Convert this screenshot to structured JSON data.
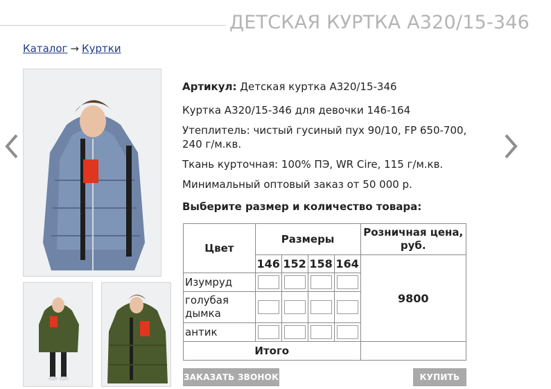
{
  "page": {
    "title": "ДЕТСКАЯ КУРТКА А320/15-346"
  },
  "breadcrumb": {
    "catalog": "Каталог",
    "separator": "→",
    "category": "Куртки"
  },
  "nav": {
    "prev_icon": "chevron-left-icon",
    "next_icon": "chevron-right-icon",
    "prev_glyph": "‹",
    "next_glyph": "›"
  },
  "product": {
    "article_label": "Артикул:",
    "article_value": "Детская куртка А320/15-346",
    "description": "Куртка А320/15-346 для девочки 146-164",
    "insulation": "Утеплитель: чистый гусиный пух 90/10, FP 650-700, 240 г/м.кв.",
    "fabric": "Ткань курточная: 100% ПЭ, WR Cire, 115 г/м.кв.",
    "min_order": "Минимальный оптовый заказ от 50 000 р."
  },
  "order": {
    "heading": "Выберите размер и количество товара:",
    "col_color": "Цвет",
    "col_sizes": "Размеры",
    "col_price": "Розничная цена, руб.",
    "sizes": [
      "146",
      "152",
      "158",
      "164"
    ],
    "colors": [
      "Изумруд",
      "голубая дымка",
      "антик"
    ],
    "price": "9800",
    "total_label": "Итого",
    "total_value": ""
  },
  "buttons": {
    "call": "ЗАКАЗАТЬ ЗВОНОК",
    "buy": "КУПИТЬ"
  },
  "colors": {
    "jacket_blue": "#6f84a6",
    "jacket_green": "#4a5a2c",
    "accent_red": "#e0351e",
    "button_gray": "#a9a9a9"
  }
}
